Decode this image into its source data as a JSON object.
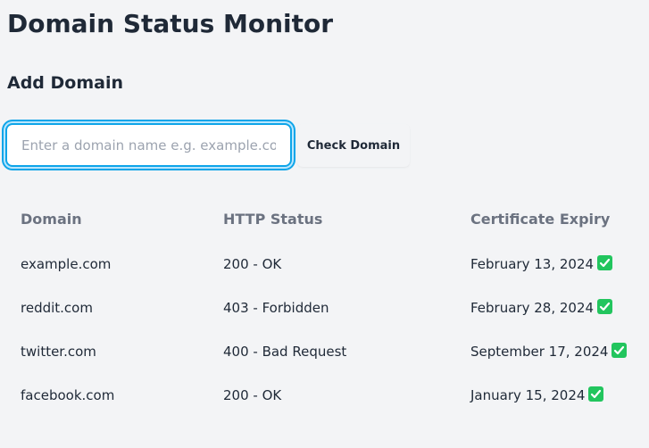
{
  "page": {
    "title": "Domain Status Monitor"
  },
  "add_domain": {
    "heading": "Add Domain",
    "input_placeholder": "Enter a domain name e.g. example.com",
    "input_value": "",
    "button_label": "Check Domain"
  },
  "table": {
    "columns": [
      "Domain",
      "HTTP Status",
      "Certificate Expiry"
    ],
    "rows": [
      {
        "domain": "example.com",
        "status": "200 - OK",
        "expiry": "February 13, 2024",
        "expiry_icon": "check-mark-icon"
      },
      {
        "domain": "reddit.com",
        "status": "403 - Forbidden",
        "expiry": "February 28, 2024",
        "expiry_icon": "check-mark-icon"
      },
      {
        "domain": "twitter.com",
        "status": "400 - Bad Request",
        "expiry": "September 17, 2024",
        "expiry_icon": "check-mark-icon"
      },
      {
        "domain": "facebook.com",
        "status": "200 - OK",
        "expiry": "January 15, 2024",
        "expiry_icon": "check-mark-icon"
      }
    ]
  },
  "colors": {
    "background": "#f3f4f6",
    "accent": "#0ea5e9",
    "check_icon": "#22c55e"
  }
}
